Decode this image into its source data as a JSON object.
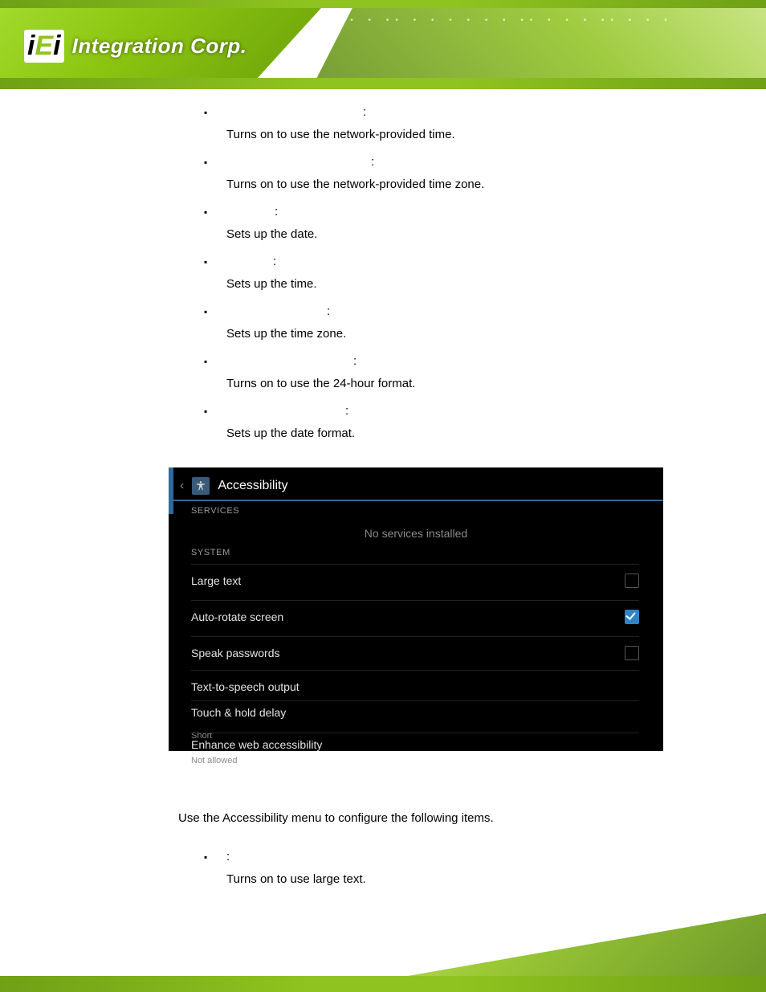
{
  "brand": {
    "logo_iei": "iEi",
    "logo_tag": "Integration Corp."
  },
  "datetime_items": [
    {
      "label": "",
      "desc": "Turns on to use the network-provided time."
    },
    {
      "label": "",
      "desc": "Turns on to use the network-provided time zone."
    },
    {
      "label": "",
      "desc": "Sets up the date."
    },
    {
      "label": "",
      "desc": "Sets up the time."
    },
    {
      "label": "",
      "desc": "Sets up the time zone."
    },
    {
      "label": "",
      "desc": "Turns on to use the 24-hour format."
    },
    {
      "label": "",
      "desc": "Sets up the date format."
    }
  ],
  "datetime_label_widths": [
    170,
    180,
    60,
    58,
    125,
    158,
    148
  ],
  "android": {
    "title": "Accessibility",
    "section_services": "SERVICES",
    "no_services": "No services installed",
    "section_system": "SYSTEM",
    "rows": {
      "large_text": {
        "label": "Large text",
        "checked": false
      },
      "auto_rotate": {
        "label": "Auto-rotate screen",
        "checked": true
      },
      "speak_pw": {
        "label": "Speak passwords",
        "checked": false
      },
      "tts": {
        "label": "Text-to-speech output"
      },
      "touch_hold": {
        "label": "Touch & hold delay",
        "sub": "Short"
      },
      "enhance": {
        "label": "Enhance web accessibility",
        "sub": "Not allowed"
      }
    }
  },
  "accessibility_intro": "Use the Accessibility menu to configure the following items.",
  "accessibility_items": [
    {
      "label": "",
      "desc": "Turns on to use large text."
    }
  ],
  "accessibility_label_widths": [
    65
  ]
}
